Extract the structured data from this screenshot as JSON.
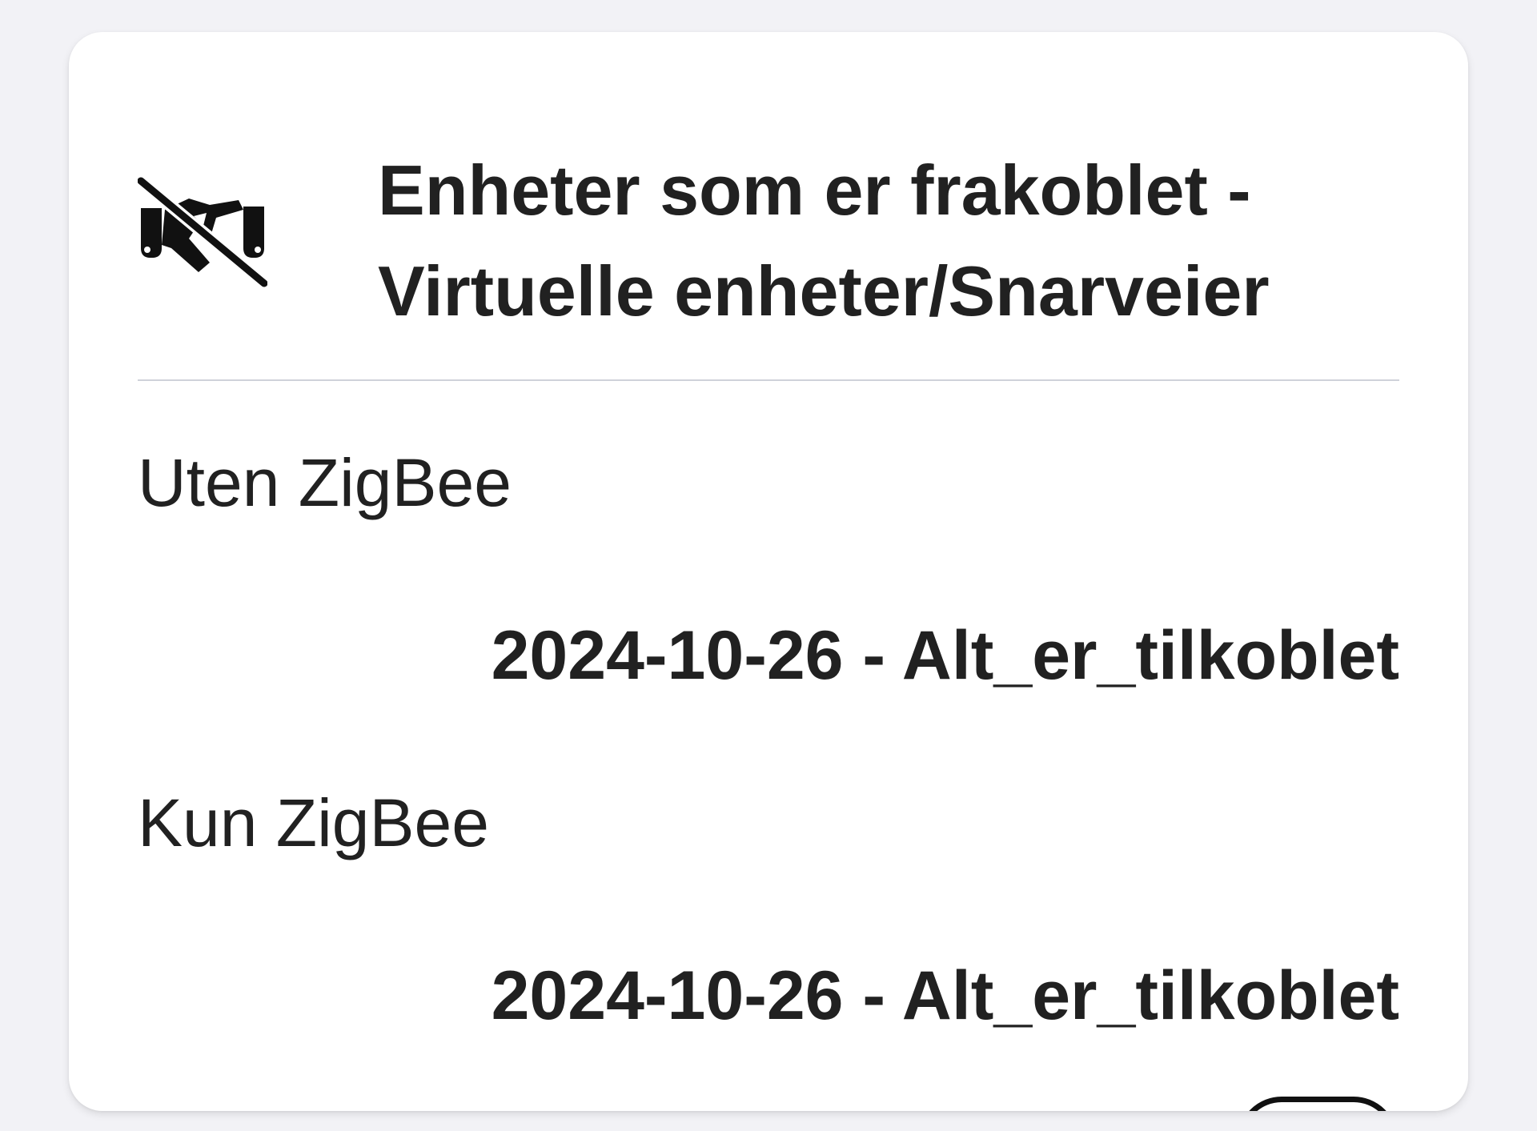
{
  "card": {
    "title": "Enheter som er frakoblet - Virtuelle enheter/Snarveier",
    "icon": "disconnected-plug-icon"
  },
  "rows": [
    {
      "label": "Uten ZigBee",
      "value": "2024-10-26 - Alt_er_tilkoblet"
    },
    {
      "label": "Kun ZigBee",
      "value": "2024-10-26 - Alt_er_tilkoblet"
    }
  ],
  "partial_row": {
    "label": "",
    "toggle_state": "on"
  }
}
